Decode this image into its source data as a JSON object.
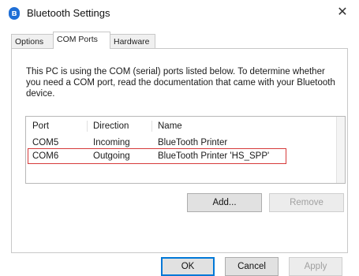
{
  "window": {
    "title": "Bluetooth Settings",
    "close_glyph": "✕",
    "icon": "bluetooth-icon"
  },
  "tabs": [
    {
      "label": "Options",
      "active": false
    },
    {
      "label": "COM Ports",
      "active": true
    },
    {
      "label": "Hardware",
      "active": false
    }
  ],
  "description": "This PC is using the COM (serial) ports listed below. To determine whether you need a COM port, read the documentation that came with your Bluetooth device.",
  "ports_table": {
    "headers": [
      "Port",
      "Direction",
      "Name"
    ],
    "rows": [
      [
        "COM5",
        "Incoming",
        "BlueTooth Printer"
      ],
      [
        "COM6",
        "Outgoing",
        "BlueTooth Printer 'HS_SPP'"
      ]
    ],
    "highlighted_row": 1,
    "highlight_color": "#d63a3a"
  },
  "buttons": {
    "add": "Add...",
    "remove": "Remove",
    "ok": "OK",
    "cancel": "Cancel",
    "apply": "Apply"
  },
  "colors": {
    "accent": "#0078d7",
    "bluetooth": "#1f6fd6"
  }
}
